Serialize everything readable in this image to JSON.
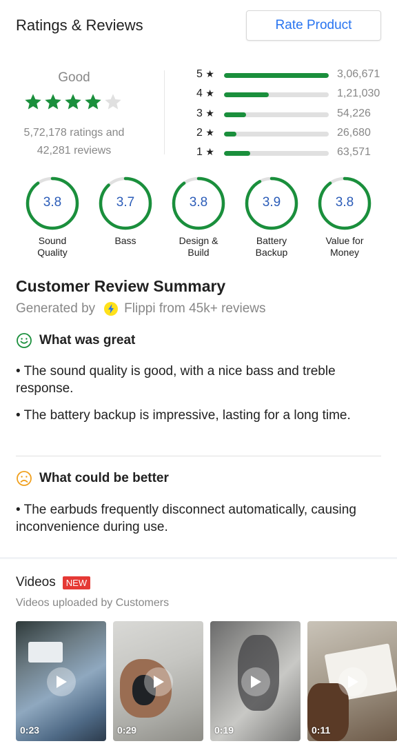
{
  "header": {
    "title": "Ratings & Reviews",
    "rate_button": "Rate Product"
  },
  "overall": {
    "label": "Good",
    "rating_stars": 4,
    "total_stars": 5,
    "ratings_text": "5,72,178 ratings and",
    "reviews_text": "42,281 reviews",
    "star_color": "#1a8f3c",
    "star_empty_color": "#e0e0e0"
  },
  "distribution": [
    {
      "label": "5",
      "count": "3,06,671",
      "fraction": 1.0
    },
    {
      "label": "4",
      "count": "1,21,030",
      "fraction": 0.43
    },
    {
      "label": "3",
      "count": "54,226",
      "fraction": 0.21
    },
    {
      "label": "2",
      "count": "26,680",
      "fraction": 0.12
    },
    {
      "label": "1",
      "count": "63,571",
      "fraction": 0.25
    }
  ],
  "star_glyph": "★",
  "aspects": [
    {
      "score": "3.8",
      "name_line1": "Sound",
      "name_line2": "Quality",
      "fraction": 0.9
    },
    {
      "score": "3.7",
      "name_line1": "Bass",
      "name_line2": "",
      "fraction": 0.88
    },
    {
      "score": "3.8",
      "name_line1": "Design &",
      "name_line2": "Build",
      "fraction": 0.9
    },
    {
      "score": "3.9",
      "name_line1": "Battery",
      "name_line2": "Backup",
      "fraction": 0.92
    },
    {
      "score": "3.8",
      "name_line1": "Value for",
      "name_line2": "Money",
      "fraction": 0.9
    }
  ],
  "summary": {
    "title": "Customer Review Summary",
    "generated_prefix": "Generated by",
    "generated_suffix": "Flippi from 45k+ reviews",
    "great_title": "What was great",
    "great_points": [
      "• The sound quality is good, with a nice bass and treble response.",
      "• The battery backup is impressive, lasting for a long time."
    ],
    "better_title": "What could be better",
    "better_points": [
      "• The earbuds frequently disconnect automatically, causing inconvenience during use."
    ]
  },
  "videos": {
    "title": "Videos",
    "badge": "NEW",
    "subtitle": "Videos uploaded by Customers",
    "items": [
      {
        "duration": "0:23"
      },
      {
        "duration": "0:29"
      },
      {
        "duration": "0:19"
      },
      {
        "duration": "0:11"
      }
    ]
  },
  "colors": {
    "accent_blue": "#2874f0",
    "rating_green": "#1a8f3c",
    "badge_red": "#e53935"
  }
}
